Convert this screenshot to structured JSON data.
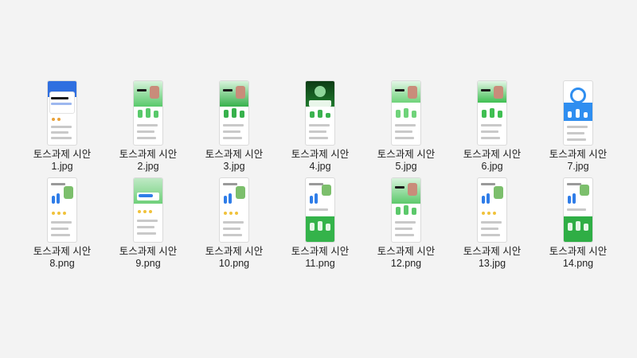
{
  "files": [
    {
      "name": "토스과제 시안",
      "ext": "1.jpg",
      "theme": "#2f6fe0",
      "style": "blue-top"
    },
    {
      "name": "토스과제 시안",
      "ext": "2.jpg",
      "theme": "#58c96a",
      "style": "green-cards"
    },
    {
      "name": "토스과제 시안",
      "ext": "3.jpg",
      "theme": "#37b14c",
      "style": "green-cards"
    },
    {
      "name": "토스과제 시안",
      "ext": "4.jpg",
      "theme": "#1e7a2c",
      "style": "dark-green"
    },
    {
      "name": "토스과제 시안",
      "ext": "5.jpg",
      "theme": "#6fd37a",
      "style": "light-green"
    },
    {
      "name": "토스과제 시안",
      "ext": "6.jpg",
      "theme": "#3fbf52",
      "style": "light-green"
    },
    {
      "name": "토스과제 시안",
      "ext": "7.jpg",
      "theme": "#2f8ef0",
      "style": "blue-ring"
    },
    {
      "name": "토스과제 시안",
      "ext": "8.png",
      "theme": "#2f7de8",
      "style": "white-blue"
    },
    {
      "name": "토스과제 시안",
      "ext": "9.png",
      "theme": "#6fd07a",
      "style": "green-top"
    },
    {
      "name": "토스과제 시안",
      "ext": "10.png",
      "theme": "#2f7de8",
      "style": "white-blue"
    },
    {
      "name": "토스과제 시안",
      "ext": "11.png",
      "theme": "#34b34a",
      "style": "green-bottom"
    },
    {
      "name": "토스과제 시안",
      "ext": "12.png",
      "theme": "#5cc96b",
      "style": "green-cards"
    },
    {
      "name": "토스과제 시안",
      "ext": "13.jpg",
      "theme": "#2f7de8",
      "style": "white-blue"
    },
    {
      "name": "토스과제 시안",
      "ext": "14.png",
      "theme": "#2fae45",
      "style": "green-bottom"
    }
  ]
}
